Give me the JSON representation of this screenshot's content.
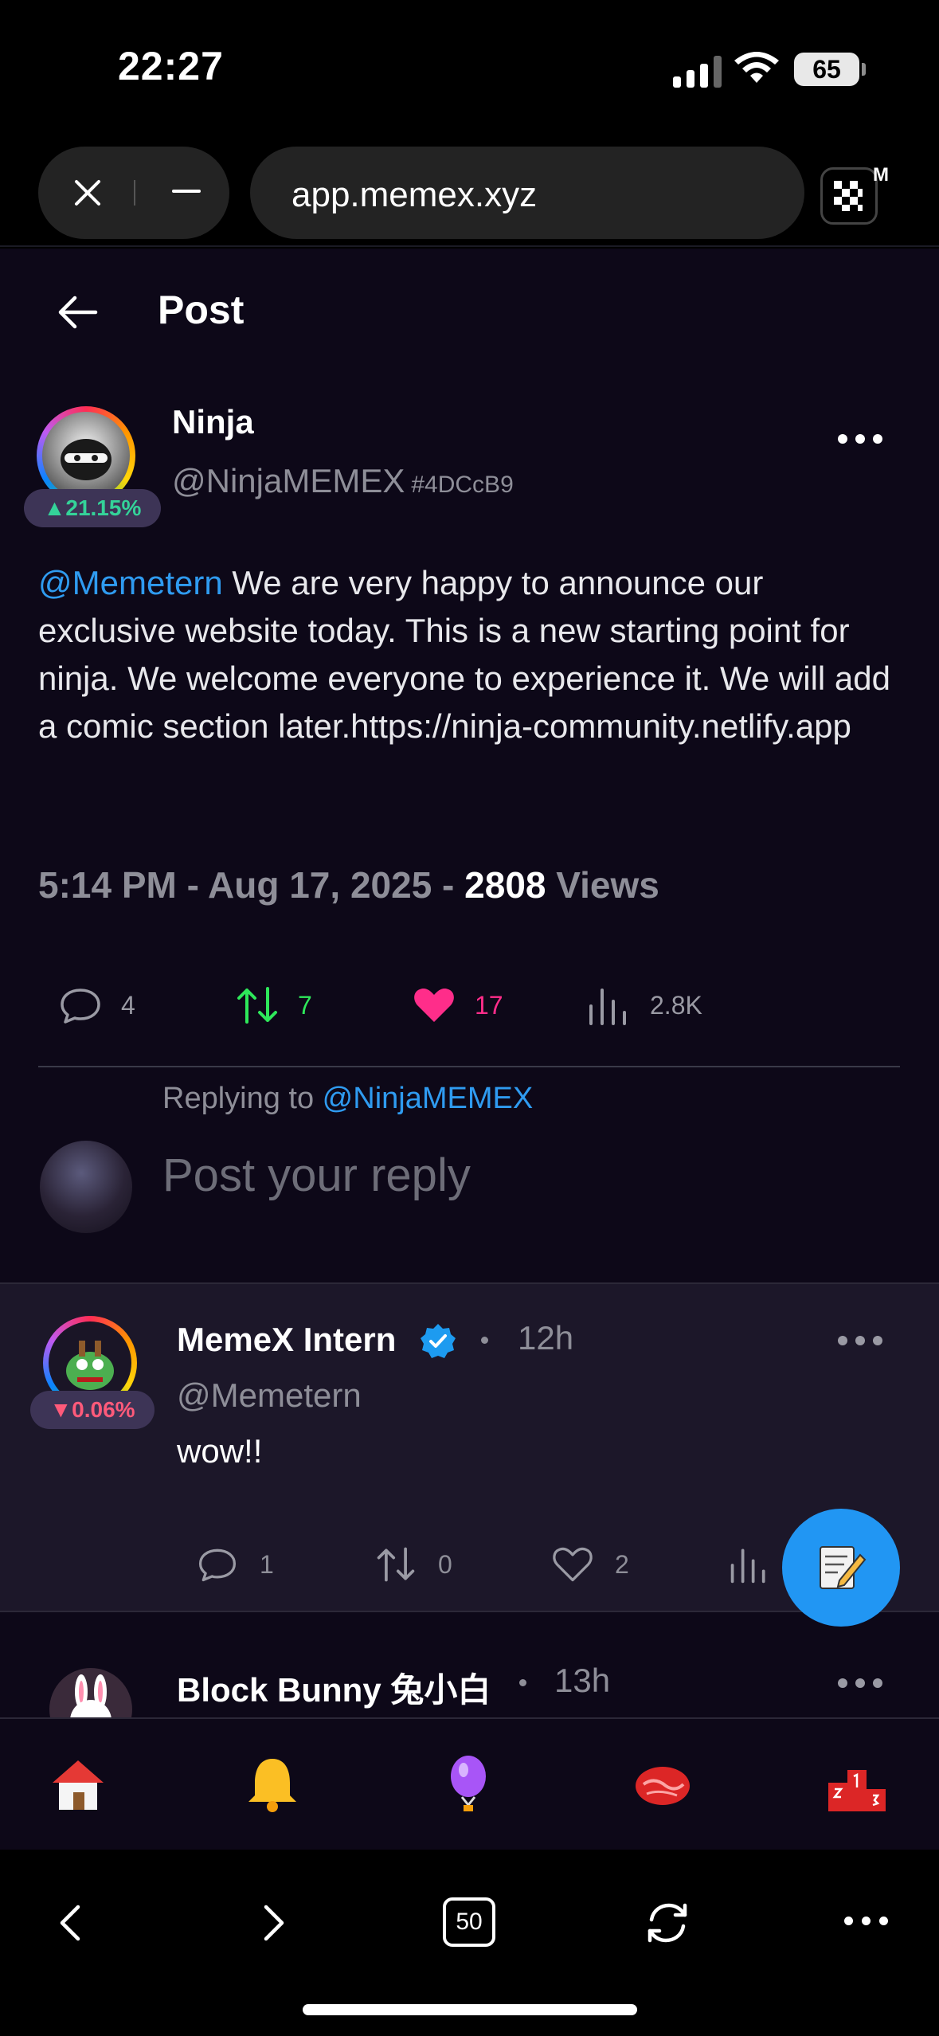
{
  "status_bar": {
    "time": "22:27",
    "battery": "65"
  },
  "browser": {
    "url": "app.memex.xyz",
    "extension_label": "M",
    "tab_count": "50"
  },
  "header": {
    "title": "Post"
  },
  "post": {
    "author_name": "Ninja",
    "author_handle": "@NinjaMEMEX",
    "author_id": "#4DCcB9",
    "change_badge": "▲21.15%",
    "mention": "@Memetern",
    "text": " We are very happy to announce our exclusive website today. This is a new starting point for ninja. We welcome everyone to experience it. We will add a comic section later.https://ninja-community.netlify.app",
    "timestamp": "5:14 PM - Aug 17, 2025 - ",
    "views_count": "2808",
    "views_label": " Views",
    "stats": {
      "replies": "4",
      "reposts": "7",
      "likes": "17",
      "views": "2.8K"
    }
  },
  "reply_box": {
    "replying_prefix": "Replying to ",
    "replying_handle": "@NinjaMEMEX",
    "placeholder": "Post your reply"
  },
  "comments": [
    {
      "name": "MemeX Intern",
      "handle": "@Memetern",
      "time": "12h",
      "badge": "▼0.06%",
      "text": "wow!!",
      "stats": {
        "replies": "1",
        "reposts": "0",
        "likes": "2"
      }
    },
    {
      "name": "Block Bunny 兔小白",
      "time": "13h"
    }
  ],
  "colors": {
    "accent": "#2f9bf0",
    "repost": "#2ee85a",
    "like": "#ff2d8a",
    "background": "#0d0818"
  },
  "nav_icons": [
    "home-icon",
    "bell-icon",
    "balloon-icon",
    "meat-icon",
    "podium-icon"
  ]
}
